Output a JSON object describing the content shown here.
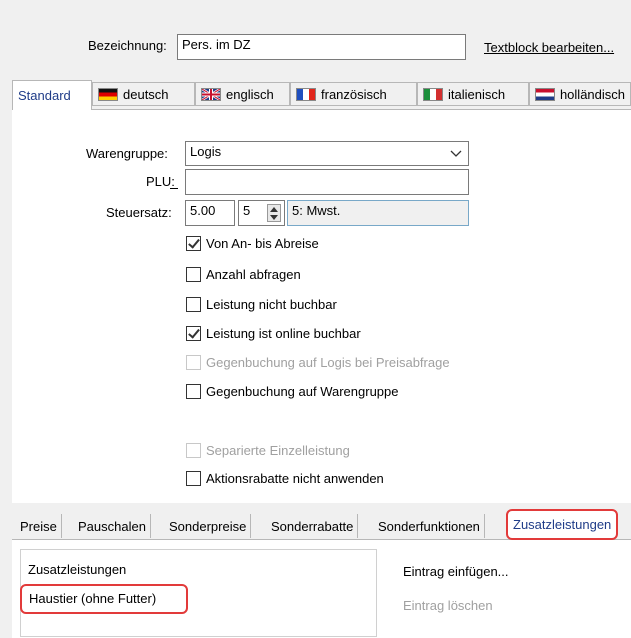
{
  "header": {
    "bezeichnung_label": "Bezeichnung:",
    "bezeichnung_value": "Pers. im DZ",
    "textblock_link": "Textblock bearbeiten..."
  },
  "language_tabs": [
    {
      "label": "Standard",
      "flag": "none",
      "active": true
    },
    {
      "label": "deutsch",
      "flag": "de-flag-icon"
    },
    {
      "label": "englisch",
      "flag": "uk-flag-icon"
    },
    {
      "label": "französisch",
      "flag": "fr-flag-icon"
    },
    {
      "label": "italienisch",
      "flag": "it-flag-icon"
    },
    {
      "label": "holländisch",
      "flag": "nl-flag-icon"
    }
  ],
  "form": {
    "warengruppe_label": "Warengruppe:",
    "warengruppe_value": "Logis",
    "plu_label": "PLU:",
    "plu_value": "",
    "steuersatz_label": "Steuersatz:",
    "steuersatz_value": "5.00",
    "steuer_spin_value": "5",
    "steuer_desc": "5: Mwst."
  },
  "checkboxes": [
    {
      "label": "Von An- bis Abreise",
      "checked": true,
      "enabled": true
    },
    {
      "label": "Anzahl abfragen",
      "checked": false,
      "enabled": true
    },
    {
      "label": "Leistung nicht buchbar",
      "checked": false,
      "enabled": true
    },
    {
      "label": "Leistung ist online buchbar",
      "checked": true,
      "enabled": true
    },
    {
      "label": "Gegenbuchung auf Logis bei Preisabfrage",
      "checked": false,
      "enabled": false
    },
    {
      "label": "Gegenbuchung auf Warengruppe",
      "checked": false,
      "enabled": true
    },
    {
      "label": "Separierte Einzelleistung",
      "checked": false,
      "enabled": false
    },
    {
      "label": "Aktionsrabatte nicht anwenden",
      "checked": false,
      "enabled": true
    }
  ],
  "bottom_tabs": [
    {
      "label": "Preise"
    },
    {
      "label": "Pauschalen"
    },
    {
      "label": "Sonderpreise"
    },
    {
      "label": "Sonderrabatte"
    },
    {
      "label": "Sonderfunktionen"
    },
    {
      "label": "Zusatzleistungen",
      "active": true
    }
  ],
  "zusatz": {
    "list_header": "Zusatzleistungen",
    "items": [
      "Haustier (ohne Futter)"
    ],
    "insert_label": "Eintrag einfügen...",
    "delete_label": "Eintrag löschen"
  },
  "colors": {
    "highlight": "#e23a3a",
    "tab_text_active": "#1f3c88"
  }
}
